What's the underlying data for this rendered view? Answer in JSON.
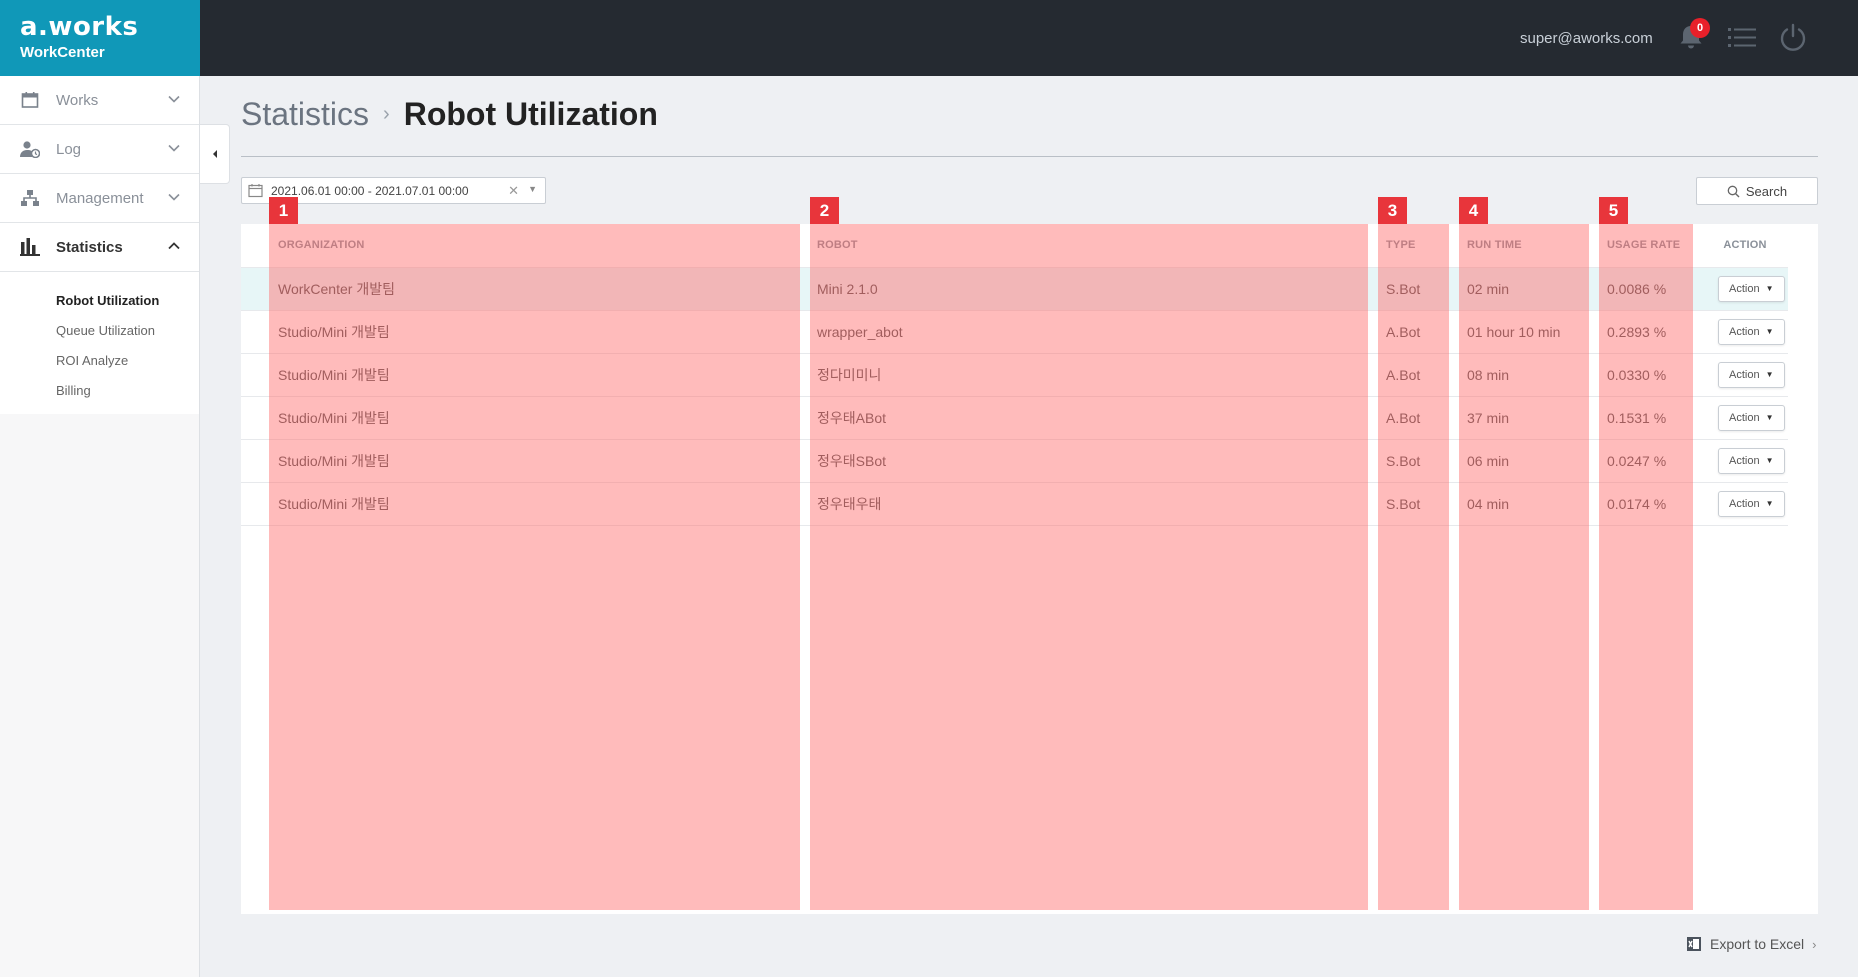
{
  "brand": {
    "logo": "a.works",
    "product": "WorkCenter"
  },
  "header": {
    "user_email": "super@aworks.com",
    "notification_count": "0"
  },
  "sidebar": {
    "items": [
      {
        "label": "Works",
        "icon": "calendar-icon"
      },
      {
        "label": "Log",
        "icon": "user-clock-icon"
      },
      {
        "label": "Management",
        "icon": "org-chart-icon"
      },
      {
        "label": "Statistics",
        "icon": "bar-chart-icon"
      }
    ],
    "sub_items": [
      {
        "label": "Robot Utilization"
      },
      {
        "label": "Queue Utilization"
      },
      {
        "label": "ROI Analyze"
      },
      {
        "label": "Billing"
      }
    ]
  },
  "breadcrumb": {
    "parent": "Statistics",
    "current": "Robot Utilization"
  },
  "filter": {
    "date_range": "2021.06.01 00:00 - 2021.07.01 00:00",
    "search_label": "Search"
  },
  "table": {
    "headers": [
      "ORGANIZATION",
      "ROBOT",
      "TYPE",
      "RUN TIME",
      "USAGE RATE",
      "ACTION"
    ],
    "rows": [
      {
        "organization": "WorkCenter 개발팀",
        "robot": "Mini 2.1.0",
        "type": "S.Bot",
        "run_time": "02 min",
        "usage_rate": "0.0086 %",
        "action": "Action"
      },
      {
        "organization": "Studio/Mini 개발팀",
        "robot": "wrapper_abot",
        "type": "A.Bot",
        "run_time": "01 hour 10 min",
        "usage_rate": "0.2893 %",
        "action": "Action"
      },
      {
        "organization": "Studio/Mini 개발팀",
        "robot": "정다미미니",
        "type": "A.Bot",
        "run_time": "08 min",
        "usage_rate": "0.0330 %",
        "action": "Action"
      },
      {
        "organization": "Studio/Mini 개발팀",
        "robot": "정우태ABot",
        "type": "A.Bot",
        "run_time": "37 min",
        "usage_rate": "0.1531 %",
        "action": "Action"
      },
      {
        "organization": "Studio/Mini 개발팀",
        "robot": "정우태SBot",
        "type": "S.Bot",
        "run_time": "06 min",
        "usage_rate": "0.0247 %",
        "action": "Action"
      },
      {
        "organization": "Studio/Mini 개발팀",
        "robot": "정우태우태",
        "type": "S.Bot",
        "run_time": "04 min",
        "usage_rate": "0.0174 %",
        "action": "Action"
      }
    ]
  },
  "overlay_labels": [
    "1",
    "2",
    "3",
    "4",
    "5"
  ],
  "footer": {
    "export_label": "Export to Excel"
  },
  "colors": {
    "brand": "#1098b8",
    "topbar": "#252a31",
    "overlay": "#ff6969",
    "badge": "#e8202a"
  }
}
